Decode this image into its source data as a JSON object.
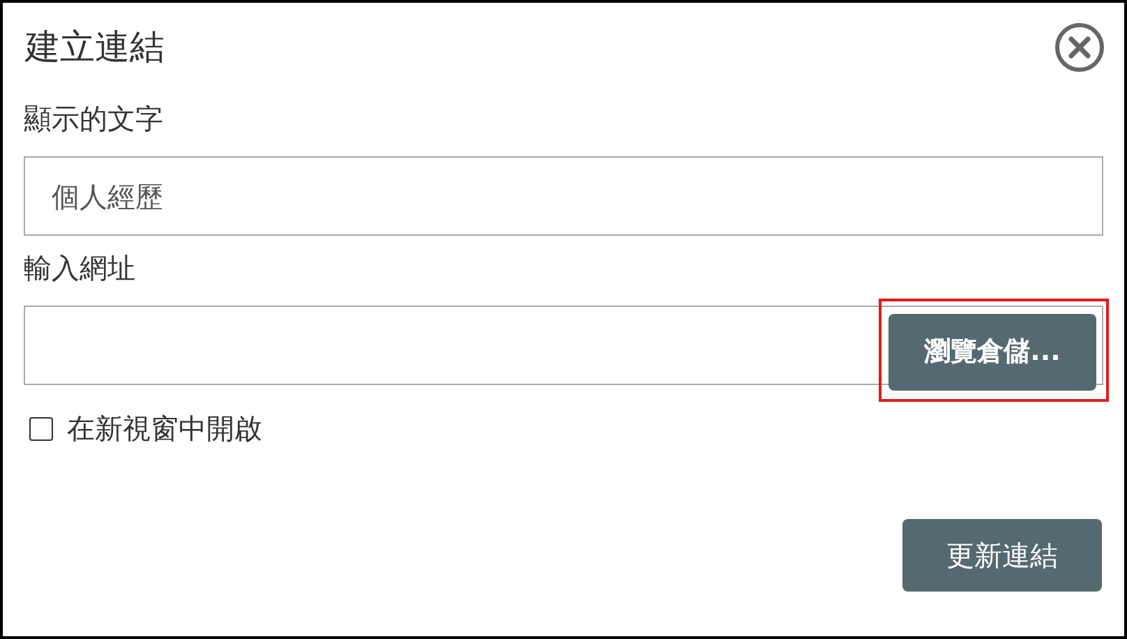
{
  "dialog": {
    "title": "建立連結"
  },
  "display_text": {
    "label": "顯示的文字",
    "value": "個人經歷"
  },
  "url": {
    "label": "輸入網址",
    "browse_button": {
      "label": "瀏覽倉儲...",
      "highlighted": true
    }
  },
  "new_window": {
    "label": "在新視窗中開啟",
    "checked": false
  },
  "buttons": [
    "更新連結"
  ]
}
